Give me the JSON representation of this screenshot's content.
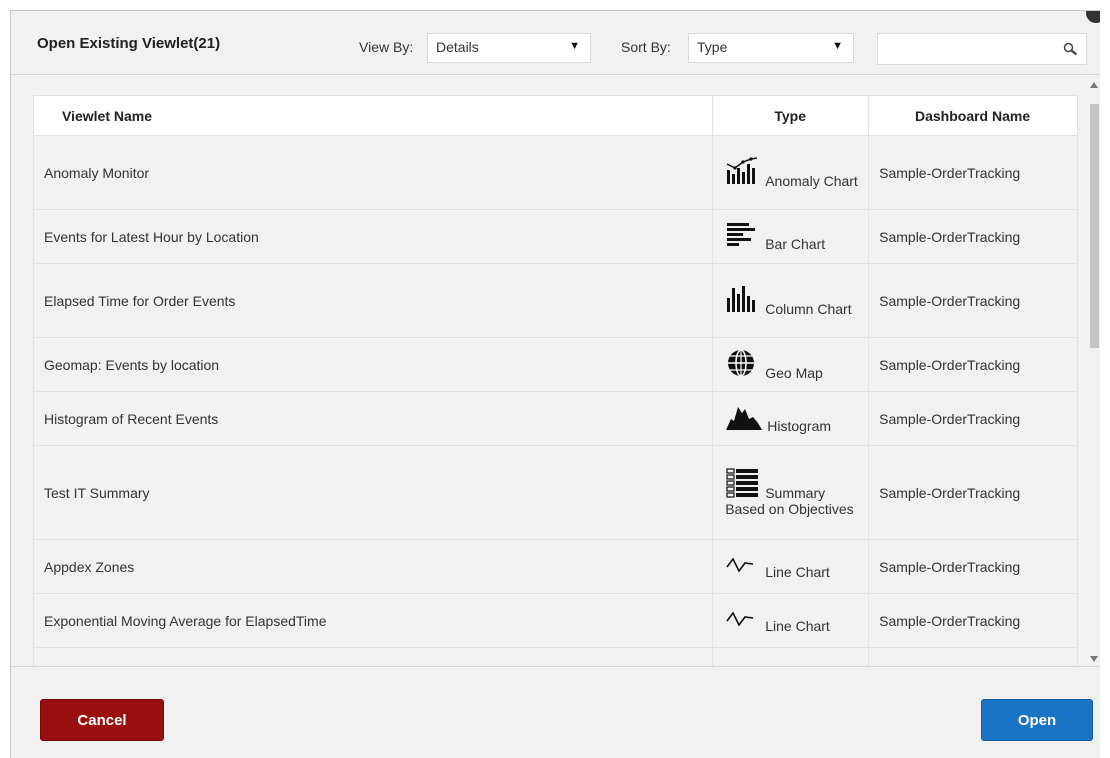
{
  "dialog": {
    "title": "Open Existing Viewlet(21)",
    "view_by": {
      "label": "View By:",
      "value": "Details"
    },
    "sort_by": {
      "label": "Sort By:",
      "value": "Type"
    },
    "search": {
      "value": "",
      "placeholder": ""
    }
  },
  "table": {
    "headers": [
      "Viewlet Name",
      "Type",
      "Dashboard Name"
    ],
    "rows": [
      {
        "name": "Anomaly Monitor",
        "type_label": "Anomaly Chart",
        "type_icon": "anomaly-chart-icon",
        "dashboard": "Sample-OrderTracking"
      },
      {
        "name": "Events for Latest Hour by Location",
        "type_label": "Bar Chart",
        "type_icon": "bar-chart-icon",
        "dashboard": "Sample-OrderTracking"
      },
      {
        "name": "Elapsed Time for Order Events",
        "type_label": "Column Chart",
        "type_icon": "column-chart-icon",
        "dashboard": "Sample-OrderTracking"
      },
      {
        "name": "Geomap: Events by location",
        "type_label": "Geo Map",
        "type_icon": "globe-icon",
        "dashboard": "Sample-OrderTracking"
      },
      {
        "name": "Histogram of Recent Events",
        "type_label": "Histogram",
        "type_icon": "histogram-icon",
        "dashboard": "Sample-OrderTracking"
      },
      {
        "name": "Test IT Summary",
        "type_label": "Summary Based on Objectives",
        "type_icon": "summary-list-icon",
        "dashboard": "Sample-OrderTracking"
      },
      {
        "name": "Appdex Zones",
        "type_label": "Line Chart",
        "type_icon": "line-chart-icon",
        "dashboard": "Sample-OrderTracking"
      },
      {
        "name": "Exponential Moving Average for ElapsedTime",
        "type_label": "Line Chart",
        "type_icon": "line-chart-icon",
        "dashboard": "Sample-OrderTracking"
      }
    ]
  },
  "footer": {
    "cancel_label": "Cancel",
    "open_label": "Open"
  },
  "colors": {
    "cancel": "#9a0f0f",
    "open": "#1a74c5",
    "background": "#f2f1f1"
  }
}
